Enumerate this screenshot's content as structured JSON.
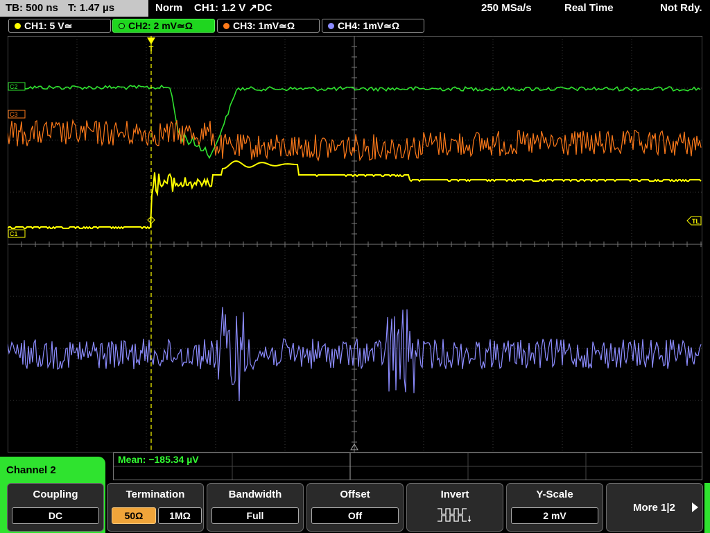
{
  "topbar": {
    "timebase": "TB: 500 ns",
    "trigger_time": "T: 1.47 µs",
    "mode": "Norm",
    "trigger": "CH1: 1.2 V ↗DC",
    "sample_rate": "250 MSa/s",
    "acq_mode": "Real Time",
    "status": "Not Rdy."
  },
  "channels": [
    {
      "label": "CH1: 5 V≃",
      "color": "#ffff00",
      "active": false
    },
    {
      "label": "CH2: 2 mV≃Ω",
      "color": "#2fe32f",
      "active": true
    },
    {
      "label": "CH3: 1mV≃Ω",
      "color": "#ff7a1a",
      "active": false
    },
    {
      "label": "CH4: 1mV≃Ω",
      "color": "#8c8cff",
      "active": false
    }
  ],
  "markers": {
    "c1": "C1",
    "c2": "C2",
    "c3": "C3",
    "trigger_level": "TL",
    "trigger_pos": "T"
  },
  "measurement": {
    "mean": "Mean: −185.34 µV"
  },
  "menu": {
    "title": "Channel 2",
    "coupling": {
      "title": "Coupling",
      "value": "DC"
    },
    "termination": {
      "title": "Termination",
      "opt1": "50Ω",
      "opt2": "1MΩ"
    },
    "bandwidth": {
      "title": "Bandwidth",
      "value": "Full"
    },
    "offset": {
      "title": "Offset",
      "value": "Off"
    },
    "invert": {
      "title": "Invert"
    },
    "yscale": {
      "title": "Y-Scale",
      "value": "2 mV"
    },
    "more": "More 1|2"
  },
  "colors": {
    "ch1": "#ffff00",
    "ch2": "#2fe32f",
    "ch3": "#ff7a1a",
    "ch4": "#8c8cff",
    "grid": "#555555"
  }
}
